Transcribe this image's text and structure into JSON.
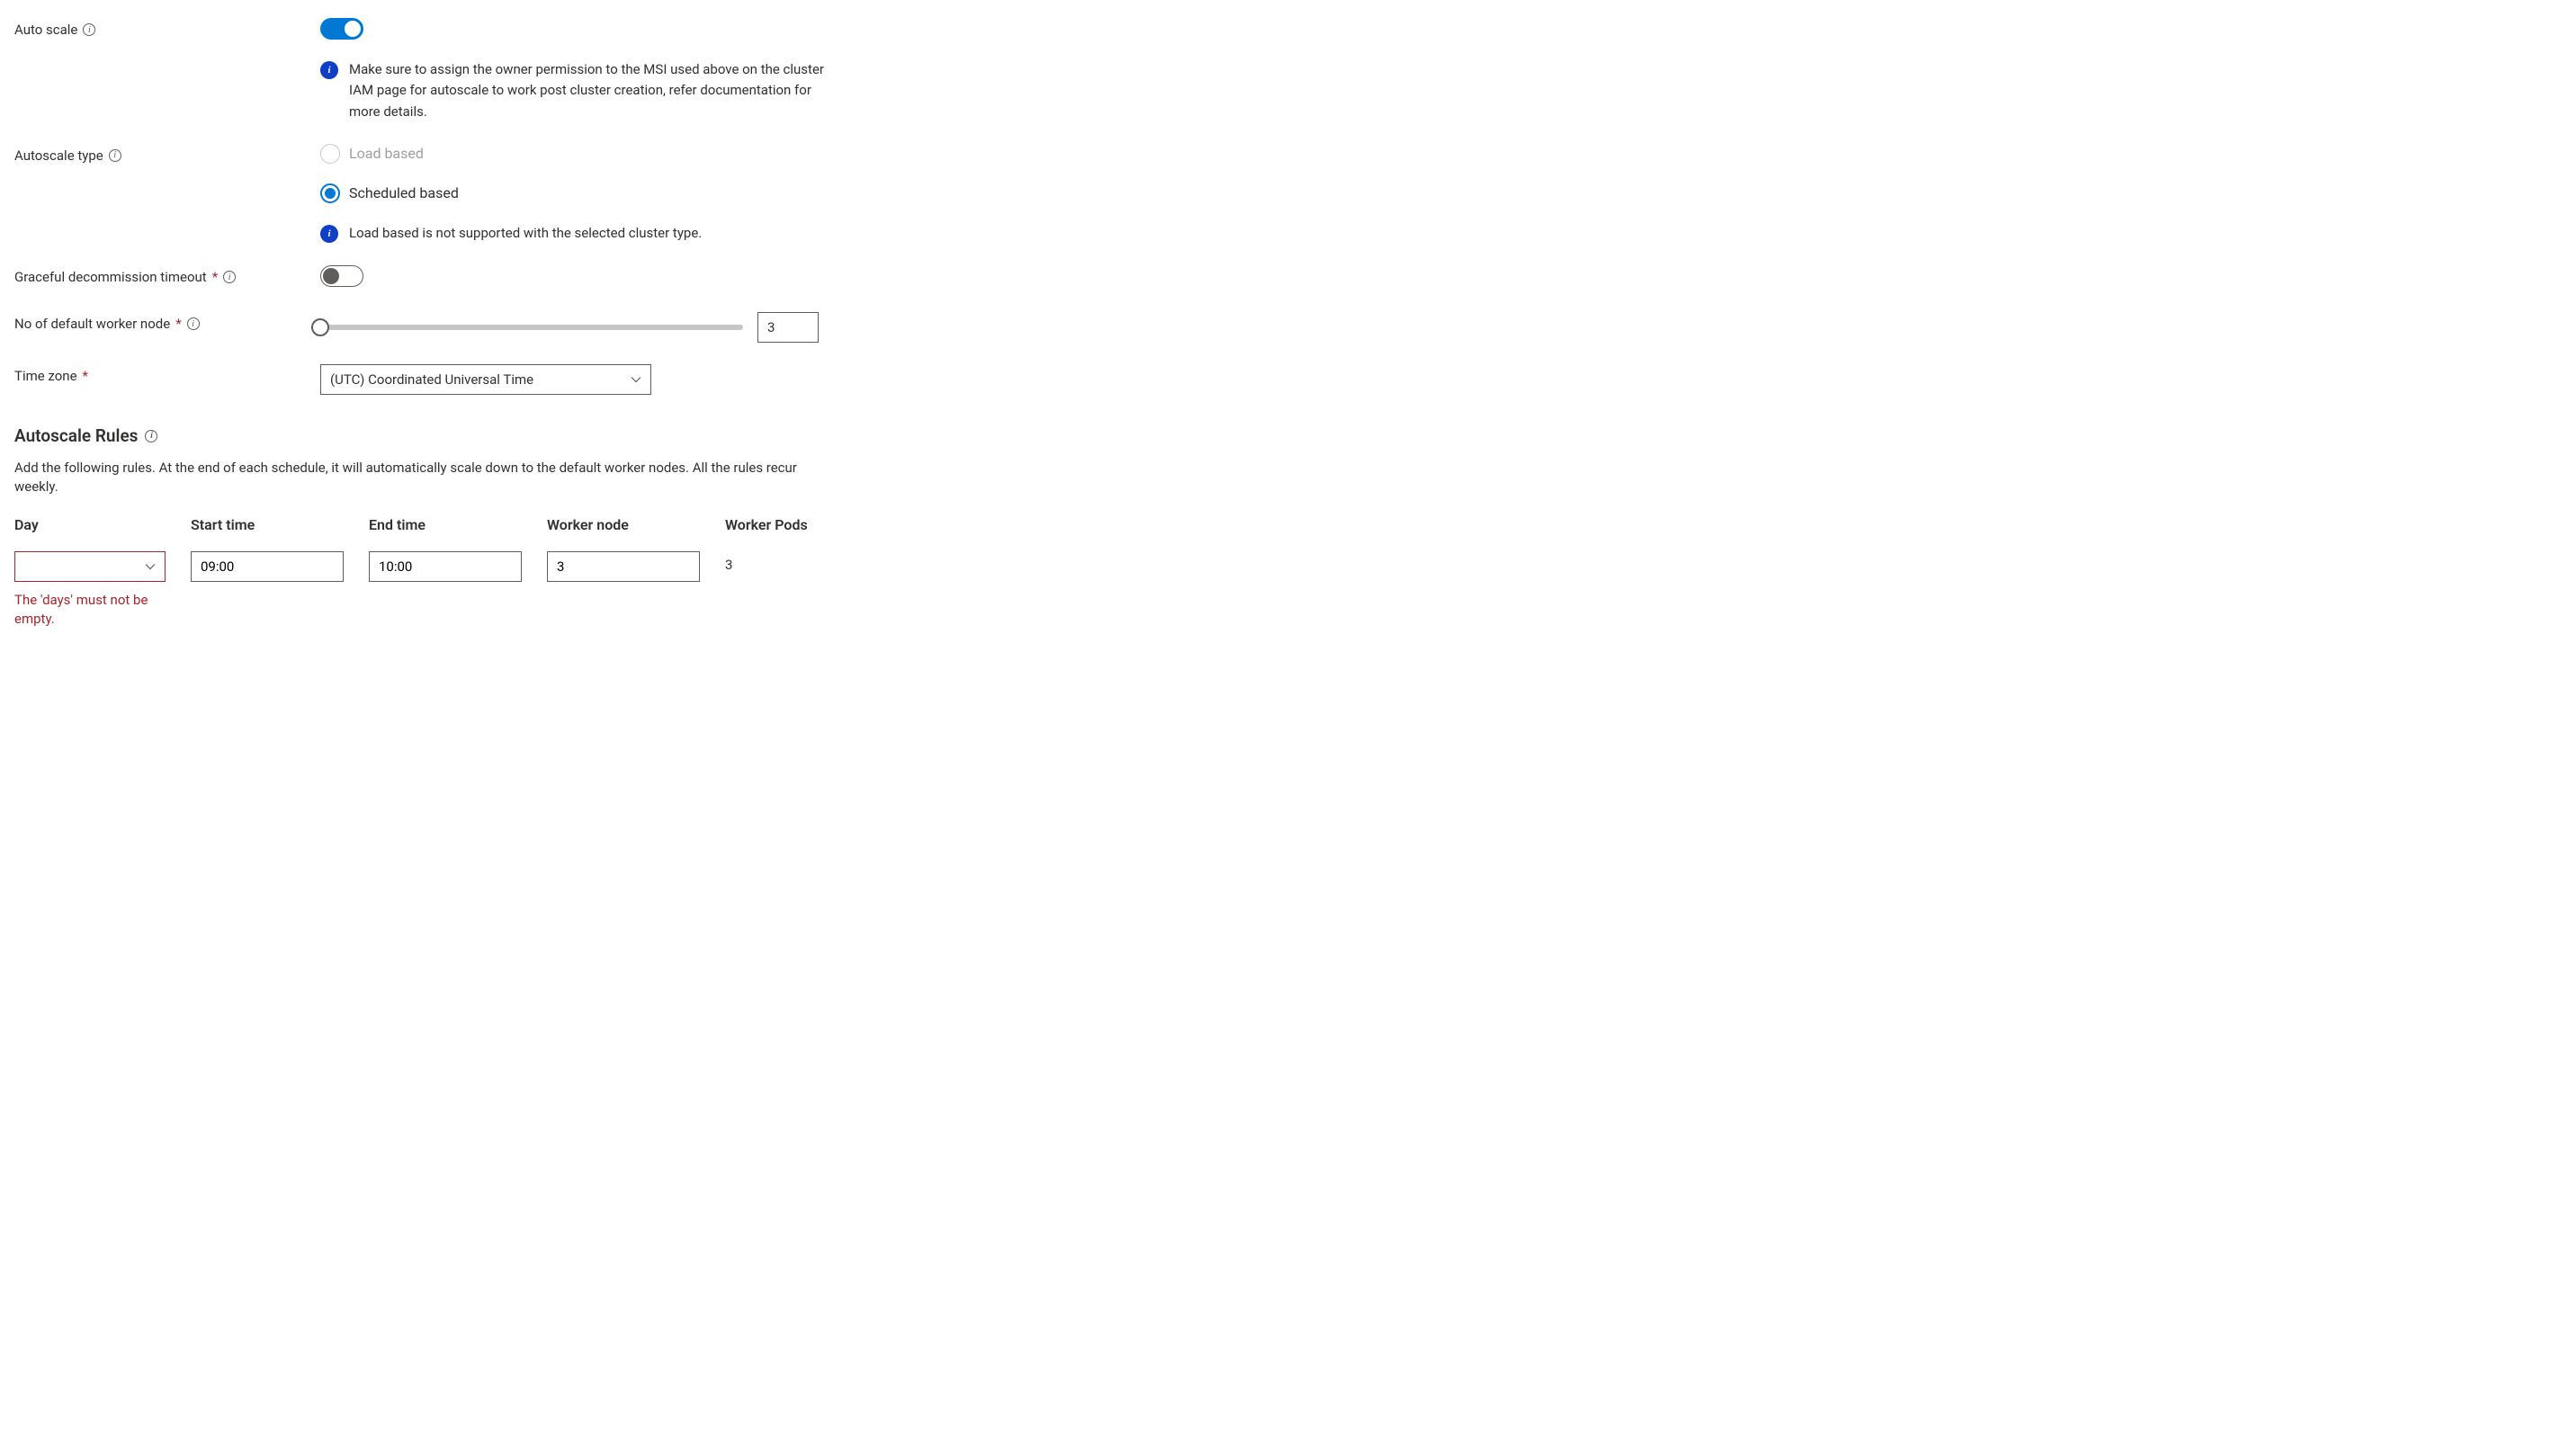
{
  "autoScale": {
    "label": "Auto scale",
    "enabled": true,
    "info": "Make sure to assign the owner permission to the MSI used above on the cluster IAM page for autoscale to work post cluster creation, refer documentation for more details."
  },
  "autoscaleType": {
    "label": "Autoscale type",
    "options": {
      "load": "Load based",
      "scheduled": "Scheduled based"
    },
    "selected": "scheduled",
    "note": "Load based is not supported with the selected cluster type."
  },
  "gracefulDecommission": {
    "label": "Graceful decommission timeout",
    "enabled": false
  },
  "defaultWorkerNode": {
    "label": "No of default worker node",
    "value": "3"
  },
  "timeZone": {
    "label": "Time zone",
    "value": "(UTC) Coordinated Universal Time"
  },
  "autoscaleRules": {
    "heading": "Autoscale Rules",
    "description": "Add the following rules. At the end of each schedule, it will automatically scale down to the default worker nodes. All the rules recur weekly.",
    "columns": {
      "day": "Day",
      "start": "Start time",
      "end": "End time",
      "worker": "Worker node",
      "pods": "Worker Pods"
    },
    "row": {
      "day": "",
      "start": "09:00",
      "end": "10:00",
      "worker": "3",
      "pods": "3"
    },
    "dayError": "The 'days' must not be empty."
  }
}
